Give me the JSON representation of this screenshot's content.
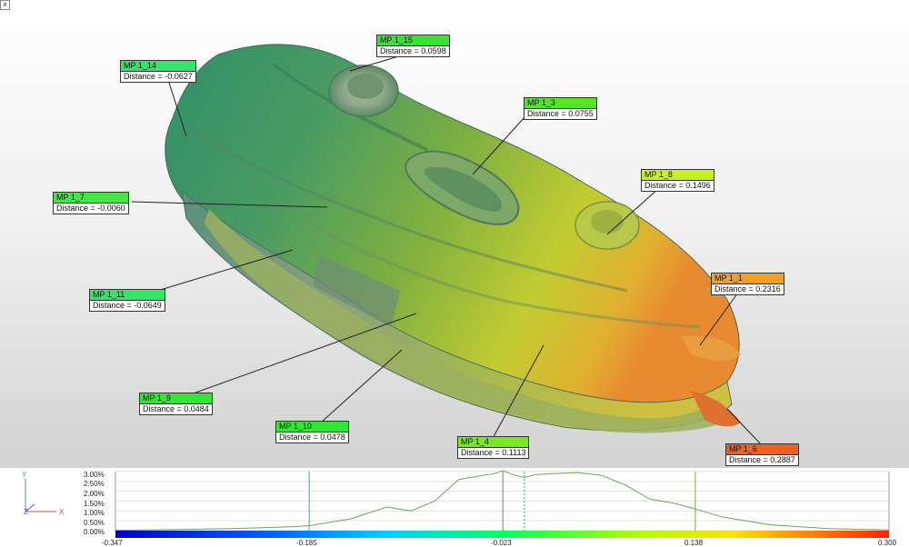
{
  "window": {
    "close_glyph": "x"
  },
  "measure_points": [
    {
      "id": "mp-1-15",
      "name": "MP 1_15",
      "distance": "Distance = 0.0598",
      "color": "#33e633"
    },
    {
      "id": "mp-1-14",
      "name": "MP 1_14",
      "distance": "Distance = -0.0627",
      "color": "#33e666"
    },
    {
      "id": "mp-1-3",
      "name": "MP 1_3",
      "distance": "Distance = 0.0755",
      "color": "#55e622"
    },
    {
      "id": "mp-1-8",
      "name": "MP 1_8",
      "distance": "Distance = 0.1496",
      "color": "#c8f020"
    },
    {
      "id": "mp-1-7",
      "name": "MP 1_7",
      "distance": "Distance = -0.0060",
      "color": "#44e644"
    },
    {
      "id": "mp-1-1",
      "name": "MP 1_1",
      "distance": "Distance = 0.2316",
      "color": "#f5a020"
    },
    {
      "id": "mp-1-11",
      "name": "MP 1_11",
      "distance": "Distance = -0.0649",
      "color": "#33e666"
    },
    {
      "id": "mp-1-9",
      "name": "MP 1_9",
      "distance": "Distance = 0.0484",
      "color": "#33e633"
    },
    {
      "id": "mp-1-10",
      "name": "MP 1_10",
      "distance": "Distance = 0.0478",
      "color": "#33e633"
    },
    {
      "id": "mp-1-4",
      "name": "MP 1_4",
      "distance": "Distance = 0.1113",
      "color": "#77e822"
    },
    {
      "id": "mp-1-6",
      "name": "MP 1_6",
      "distance": "Distance = 0.2887",
      "color": "#f06020"
    }
  ],
  "axes_gizmo": {
    "y": "Y",
    "z": "Z",
    "x": "X"
  },
  "histogram": {
    "y_ticks": [
      "3.00%",
      "2.50%",
      "2.00%",
      "1.50%",
      "1.00%",
      "0.50%",
      "0.00%"
    ],
    "x_ticks": [
      "-0.347",
      "-0.185",
      "-0.023",
      "0.138",
      "0.300"
    ],
    "colors": {
      "line": "#6aa55a",
      "marker1": "#4aa0c0",
      "marker2": "#33aa33",
      "marker3": "#88aa33"
    }
  },
  "chart_data": {
    "type": "line",
    "title": "",
    "xlabel": "",
    "ylabel": "",
    "xlim": [
      -0.347,
      0.3
    ],
    "ylim": [
      0,
      3.0
    ],
    "x": [
      -0.347,
      -0.3,
      -0.25,
      -0.2,
      -0.185,
      -0.15,
      -0.12,
      -0.1,
      -0.08,
      -0.06,
      -0.04,
      -0.03,
      -0.023,
      -0.015,
      -0.005,
      0.005,
      0.02,
      0.04,
      0.06,
      0.08,
      0.1,
      0.12,
      0.138,
      0.16,
      0.2,
      0.25,
      0.3
    ],
    "series": [
      {
        "values": [
          0.02,
          0.05,
          0.1,
          0.2,
          0.25,
          0.6,
          1.2,
          1.0,
          1.5,
          2.6,
          2.8,
          2.9,
          3.05,
          2.85,
          2.7,
          2.85,
          2.9,
          2.95,
          2.8,
          2.3,
          1.6,
          1.4,
          1.1,
          0.7,
          0.3,
          0.1,
          0.03
        ]
      }
    ],
    "markers": [
      -0.185,
      -0.023,
      -0.005,
      0.138
    ]
  }
}
